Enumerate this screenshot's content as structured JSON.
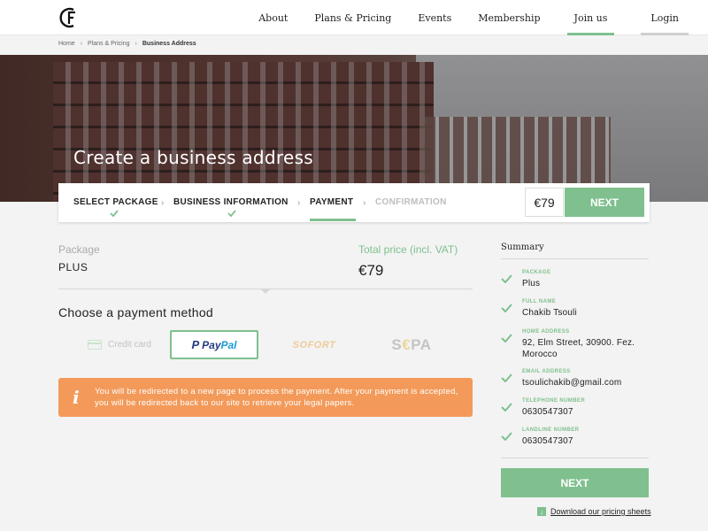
{
  "nav": {
    "items": [
      "About",
      "Plans & Pricing",
      "Events",
      "Membership",
      "Join us",
      "Login"
    ]
  },
  "breadcrumb": {
    "items": [
      "Home",
      "Plans & Pricing",
      "Business Address"
    ],
    "separator": "›"
  },
  "hero": {
    "title": "Create a business address"
  },
  "stepper": {
    "steps": [
      "SELECT PACKAGE",
      "BUSINESS INFORMATION",
      "PAYMENT",
      "CONFIRMATION"
    ],
    "price": "€79",
    "next_label": "NEXT"
  },
  "package": {
    "label": "Package",
    "value": "PLUS",
    "total_label": "Total price (incl. VAT)",
    "total_value": "€79"
  },
  "payment": {
    "heading": "Choose a payment method",
    "methods": {
      "credit_card": "Credit card",
      "paypal_pay": "Pay",
      "paypal_pal": "Pal",
      "sofort": "SOFORT",
      "sepa_s": "S",
      "sepa_e": "€",
      "sepa_pa": "PA"
    },
    "selected": "PayPal",
    "info": "You will be redirected to a new page to process the payment. After  your payment is accepted, you will be redirected back to our site to retrieve your legal papers."
  },
  "summary": {
    "title": "Summary",
    "items": [
      {
        "key": "PACKAGE",
        "value": "Plus"
      },
      {
        "key": "FULL NAME",
        "value": "Chakib Tsouli"
      },
      {
        "key": "HOME ADDRESS",
        "value": "92, Elm Street, 30900. Fez. Morocco"
      },
      {
        "key": "EMAIL ADDRESS",
        "value": "tsoulichakib@gmail.com"
      },
      {
        "key": "TELEPHONE NUMBER",
        "value": "0630547307"
      },
      {
        "key": "LANDLINE NUMBER",
        "value": "0630547307"
      }
    ],
    "next_label": "NEXT",
    "download_label": "Download our pricing sheets"
  },
  "colors": {
    "accent": "#7fc08e",
    "info": "#f39a5a",
    "paypal_dark": "#253b80",
    "paypal_light": "#179bd7"
  }
}
